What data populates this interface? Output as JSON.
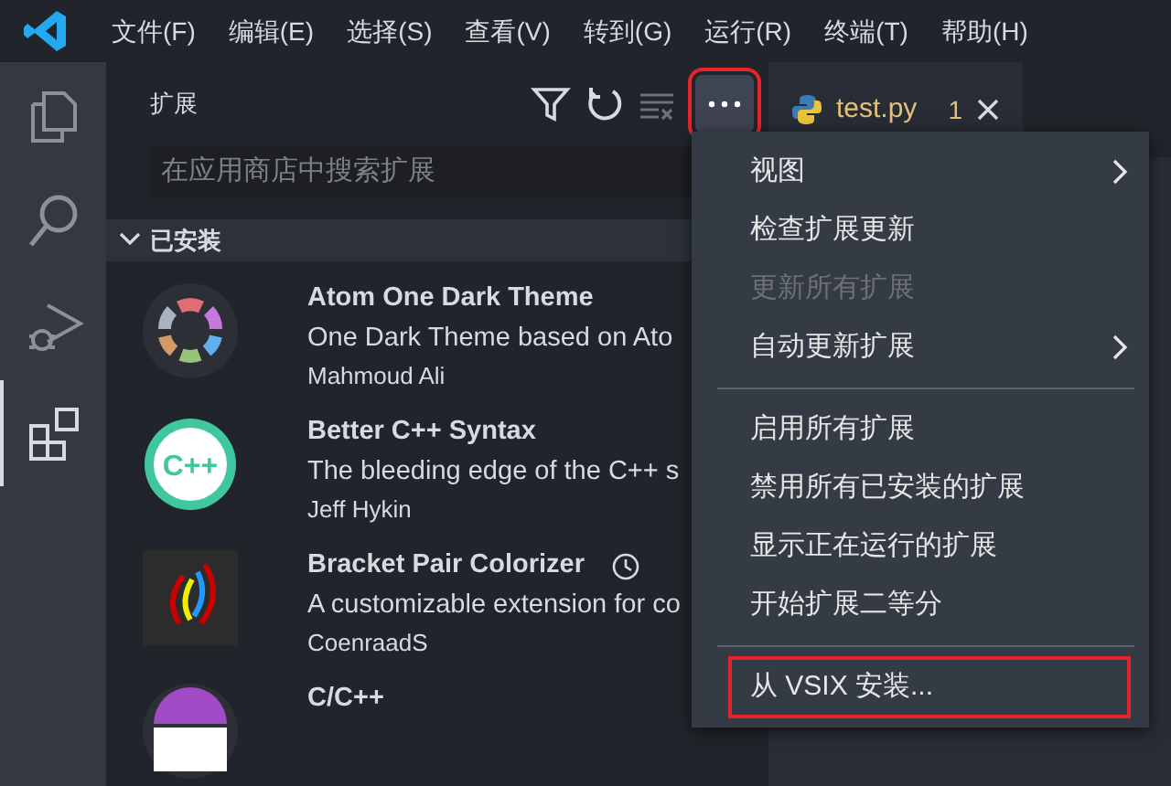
{
  "menubar": {
    "items": [
      "文件(F)",
      "编辑(E)",
      "选择(S)",
      "查看(V)",
      "转到(G)",
      "运行(R)",
      "终端(T)",
      "帮助(H)"
    ]
  },
  "activity_bar": {
    "items": [
      {
        "kind": "files",
        "selected": false
      },
      {
        "kind": "search",
        "selected": false
      },
      {
        "kind": "debug",
        "selected": false
      },
      {
        "kind": "extensions",
        "selected": true
      }
    ]
  },
  "sidebar": {
    "title": "扩展",
    "more_button_highlighted": true,
    "search": {
      "placeholder": "在应用商店中搜索扩展"
    },
    "section": {
      "title": "已安装",
      "expanded": true
    },
    "extensions": [
      {
        "name": "Atom One Dark Theme",
        "description": "One Dark Theme based on Ato",
        "author": "Mahmoud Ali",
        "kind": "atom",
        "history": false
      },
      {
        "name": "Better C++ Syntax",
        "description": "The bleeding edge of the C++ s",
        "author": "Jeff Hykin",
        "kind": "cpp",
        "logo_text": "C++",
        "history": false
      },
      {
        "name": "Bracket Pair Colorizer",
        "description": "A customizable extension for co",
        "author": "CoenraadS",
        "kind": "brackets",
        "history": true
      },
      {
        "name": "C/C++",
        "kind": "cfamily",
        "history": false
      }
    ]
  },
  "editor": {
    "tabs": [
      {
        "label": "test.py",
        "problems": "1",
        "selected": true
      }
    ]
  },
  "context_menu": {
    "items": [
      {
        "kind": "item",
        "label": "视图",
        "submenu": true,
        "disabled": false,
        "highlighted": false
      },
      {
        "kind": "item",
        "label": "检查扩展更新",
        "submenu": false,
        "disabled": false,
        "highlighted": false
      },
      {
        "kind": "item",
        "label": "更新所有扩展",
        "submenu": false,
        "disabled": true,
        "highlighted": false
      },
      {
        "kind": "item",
        "label": "自动更新扩展",
        "submenu": true,
        "disabled": false,
        "highlighted": false
      },
      {
        "kind": "separator"
      },
      {
        "kind": "item",
        "label": "启用所有扩展",
        "submenu": false,
        "disabled": false,
        "highlighted": false
      },
      {
        "kind": "item",
        "label": "禁用所有已安装的扩展",
        "submenu": false,
        "disabled": false,
        "highlighted": false
      },
      {
        "kind": "item",
        "label": "显示正在运行的扩展",
        "submenu": false,
        "disabled": false,
        "highlighted": false
      },
      {
        "kind": "item",
        "label": "开始扩展二等分",
        "submenu": false,
        "disabled": false,
        "highlighted": false
      },
      {
        "kind": "separator"
      },
      {
        "kind": "item",
        "label": "从 VSIX 安装...",
        "submenu": false,
        "disabled": false,
        "highlighted": true
      }
    ]
  }
}
